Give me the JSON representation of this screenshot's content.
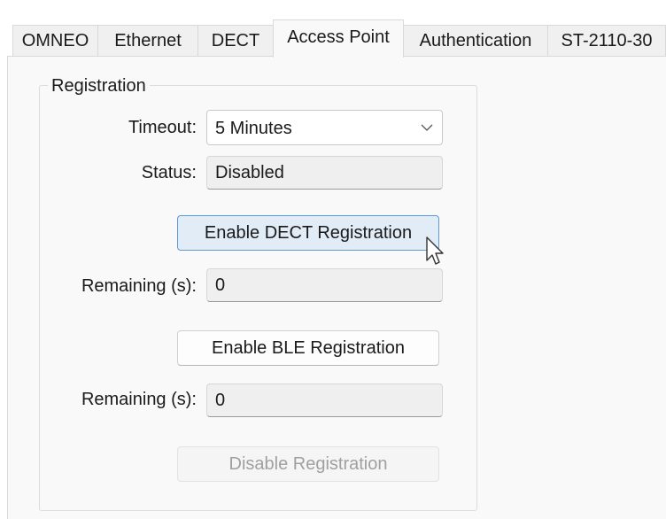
{
  "tabs": [
    {
      "label": "OMNEO",
      "active": false
    },
    {
      "label": "Ethernet",
      "active": false
    },
    {
      "label": "DECT",
      "active": false
    },
    {
      "label": "Access Point",
      "active": true
    },
    {
      "label": "Authentication",
      "active": false
    },
    {
      "label": "ST-2110-30",
      "active": false
    }
  ],
  "registration": {
    "group_title": "Registration",
    "timeout_label": "Timeout:",
    "timeout_value": "5 Minutes",
    "status_label": "Status:",
    "status_value": "Disabled",
    "enable_dect_button": "Enable DECT Registration",
    "dect_remaining_label": "Remaining (s):",
    "dect_remaining_value": "0",
    "enable_ble_button": "Enable BLE Registration",
    "ble_remaining_label": "Remaining (s):",
    "ble_remaining_value": "0",
    "disable_button": "Disable Registration"
  },
  "icons": {
    "dropdown": "chevron-down-icon",
    "cursor": "mouse-pointer-icon"
  },
  "colors": {
    "hover_button_bg": "#e1ecf7",
    "hover_button_border": "#5a9bd8",
    "disabled_text": "#a0a0a0"
  }
}
